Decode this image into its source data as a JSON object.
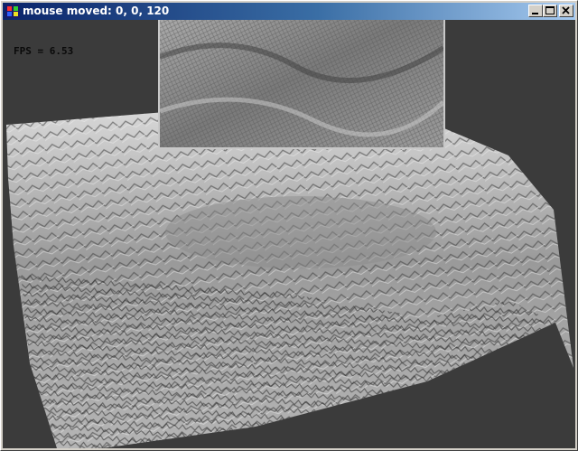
{
  "window": {
    "title": "mouse moved: 0, 0, 120",
    "minimize_icon": "minimize-icon",
    "maximize_icon": "maximize-icon",
    "close_icon": "close-icon"
  },
  "overlay": {
    "fps_text": "FPS = 6.53"
  },
  "colors": {
    "background": "#3b3b3b",
    "titlebar_start": "#0a246a",
    "titlebar_end": "#a6caf0",
    "terrain_light": "#d9d9d9",
    "terrain_dark": "#2a2a2a"
  }
}
